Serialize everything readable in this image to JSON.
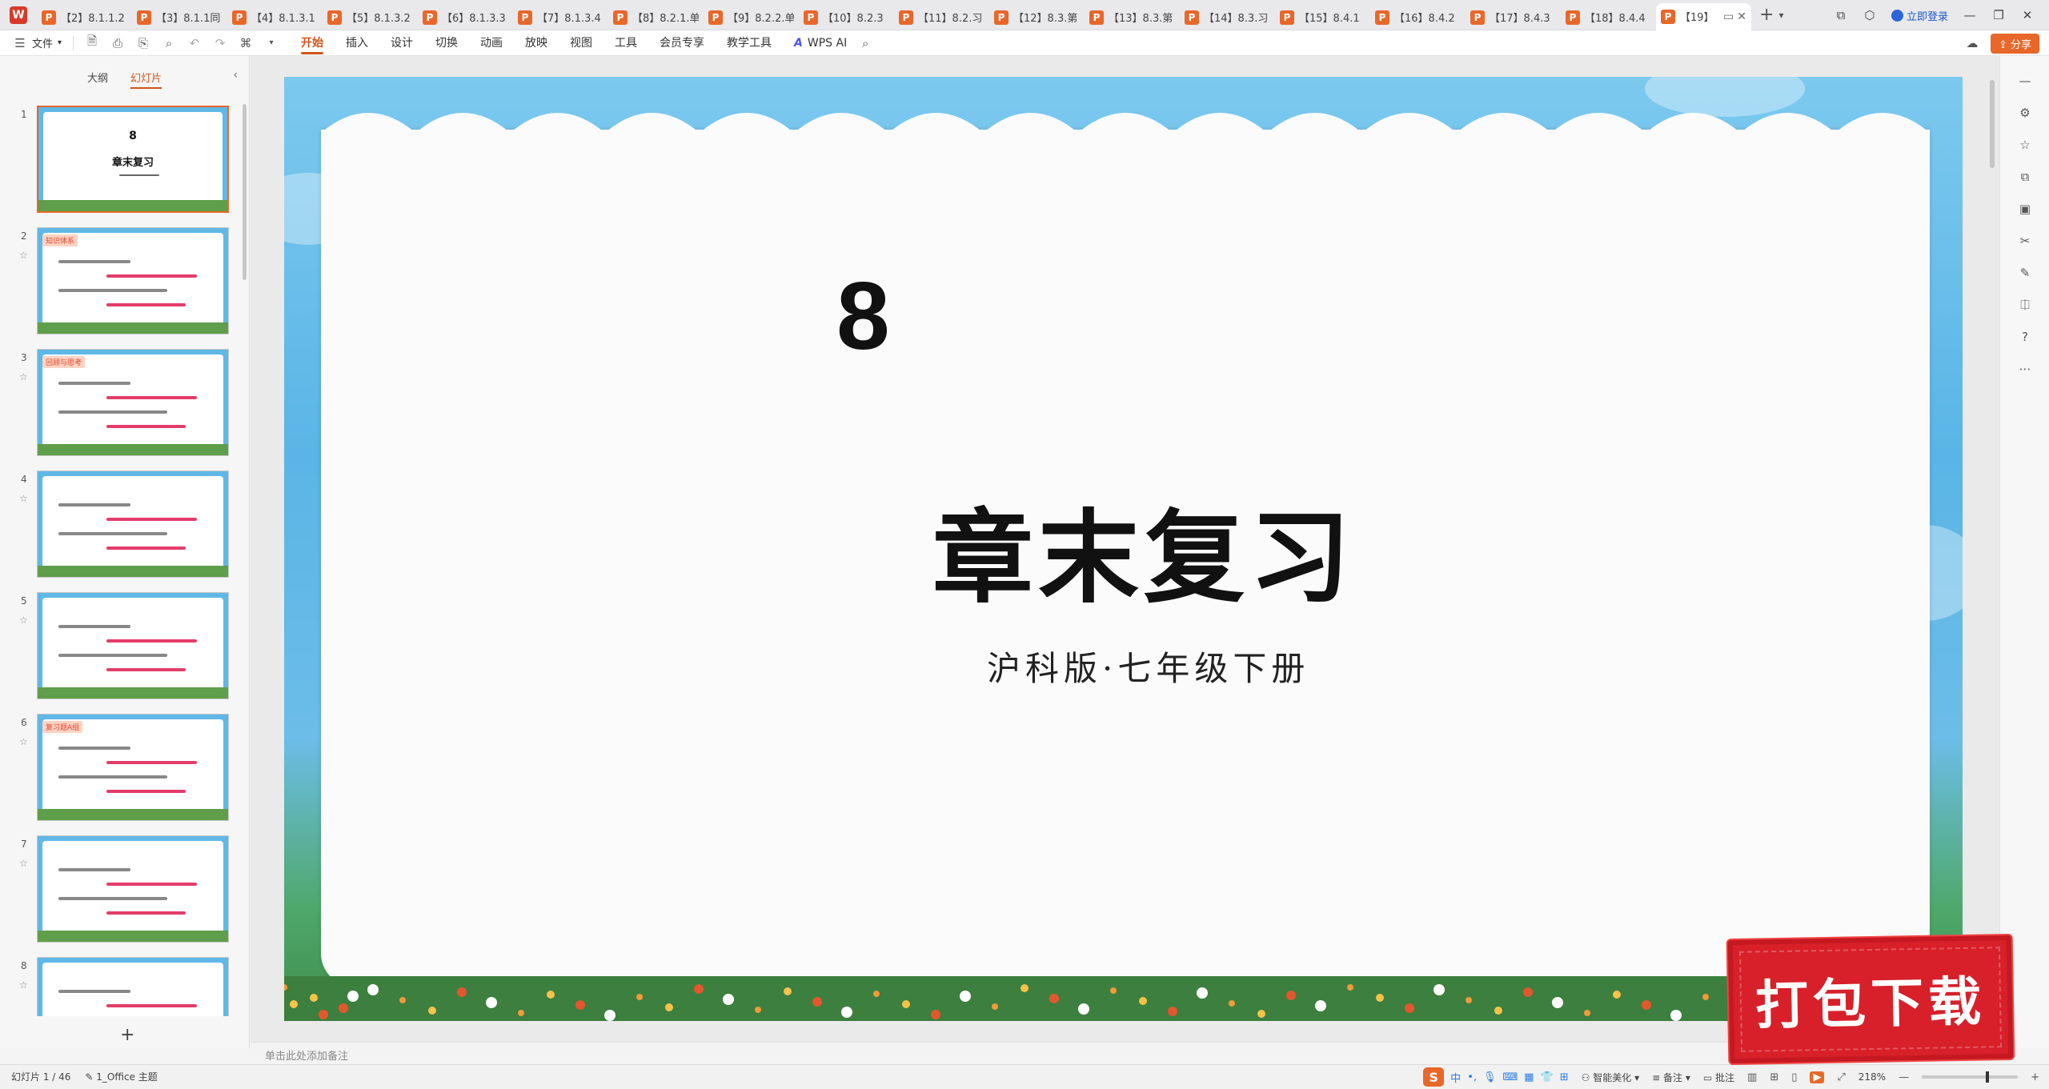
{
  "tabs": {
    "items": [
      {
        "label": "【2】8.1.1.2"
      },
      {
        "label": "【3】8.1.1同"
      },
      {
        "label": "【4】8.1.3.1"
      },
      {
        "label": "【5】8.1.3.2"
      },
      {
        "label": "【6】8.1.3.3"
      },
      {
        "label": "【7】8.1.3.4"
      },
      {
        "label": "【8】8.2.1.单"
      },
      {
        "label": "【9】8.2.2.单"
      },
      {
        "label": "【10】8.2.3"
      },
      {
        "label": "【11】8.2.习"
      },
      {
        "label": "【12】8.3.第"
      },
      {
        "label": "【13】8.3.第"
      },
      {
        "label": "【14】8.3.习"
      },
      {
        "label": "【15】8.4.1"
      },
      {
        "label": "【16】8.4.2"
      },
      {
        "label": "【17】8.4.3"
      },
      {
        "label": "【18】8.4.4"
      }
    ],
    "active_label": "【19】",
    "login": "立即登录"
  },
  "ribbon": {
    "file": "文件",
    "tabs": [
      "开始",
      "插入",
      "设计",
      "切换",
      "动画",
      "放映",
      "视图",
      "工具",
      "会员专享",
      "教学工具"
    ],
    "ai": "WPS AI",
    "share": "分享"
  },
  "panel": {
    "tab_outline": "大纲",
    "tab_slides": "幻灯片",
    "thumbs": [
      {
        "num": "1",
        "big": "8",
        "title": "章末复习"
      },
      {
        "num": "2",
        "tag": "知识体系"
      },
      {
        "num": "3",
        "tag": "回顾与思考"
      },
      {
        "num": "4"
      },
      {
        "num": "5"
      },
      {
        "num": "6",
        "tag": "复习题A组"
      },
      {
        "num": "7"
      },
      {
        "num": "8"
      }
    ]
  },
  "slide": {
    "number": "8",
    "title": "章末复习",
    "subtitle": "沪科版·七年级下册"
  },
  "notes": {
    "placeholder": "单击此处添加备注"
  },
  "status": {
    "slide_indicator": "幻灯片 1 / 46",
    "theme": "1_Office 主题",
    "beautify": "智能美化",
    "notes": "备注",
    "comments": "批注",
    "zoom": "218%"
  },
  "badge": {
    "text": "打包下载"
  },
  "colors": {
    "accent": "#d2541b",
    "tab_icon": "#e8672a",
    "badge": "#d7202a",
    "sky": "#5ab5e6"
  }
}
